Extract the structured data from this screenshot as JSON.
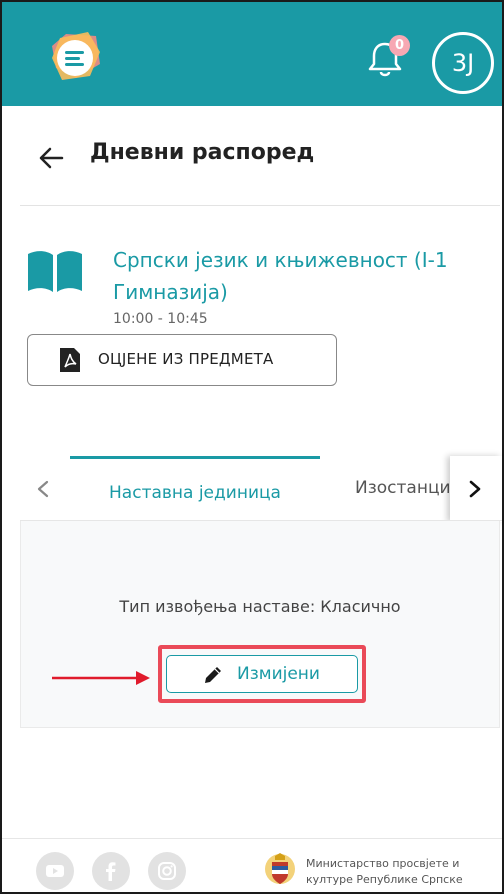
{
  "topbar": {
    "logo": "app-logo",
    "notification_count": "0",
    "avatar_initials": "3J",
    "bg_color": "#1a9aa5"
  },
  "page": {
    "back_icon": "arrow-left-icon",
    "title": "Дневни распоред"
  },
  "lesson": {
    "subject": "Српски језик и књижевност (I-1 Гимназија)",
    "time": "10:00 - 10:45",
    "grades_button": "ОЦЈЕНЕ ИЗ ПРЕДМЕТА"
  },
  "tabs": {
    "items": [
      {
        "label": "Наставна јединица",
        "active": true
      },
      {
        "label": "Изостанци",
        "active": false
      }
    ]
  },
  "panel": {
    "type_text": "Тип извођења наставе: Класично",
    "edit_button": "Измијени"
  },
  "footer": {
    "social": [
      "youtube-icon",
      "facebook-icon",
      "instagram-icon"
    ],
    "ministry_line1": "Министарство просвјете и",
    "ministry_line2": "културе Републике Српске"
  },
  "colors": {
    "accent": "#1a9aa5",
    "highlight": "#ea4a58"
  }
}
